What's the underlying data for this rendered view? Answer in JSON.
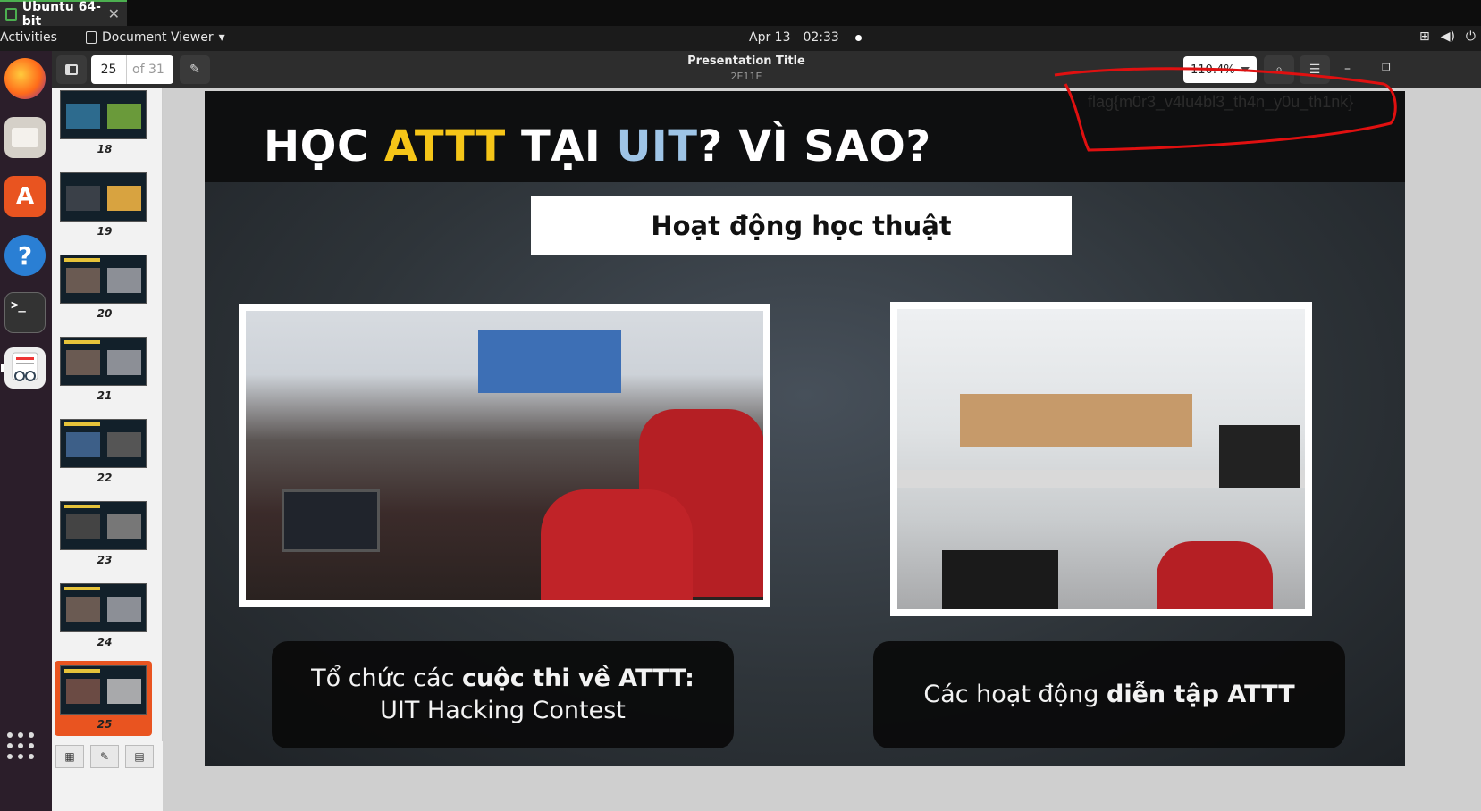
{
  "vm": {
    "tab_title": "Ubuntu 64-bit",
    "close_glyph": "✕"
  },
  "topbar": {
    "activities": "Activities",
    "app_name": "Document Viewer",
    "date": "Apr 13",
    "time": "02:33",
    "tray_icons": [
      "network-icon",
      "volume-icon",
      "power-icon"
    ]
  },
  "dock": {
    "apps": [
      "firefox-icon",
      "files-icon",
      "software-icon",
      "help-icon",
      "terminal-icon",
      "document-viewer-icon",
      "show-apps-icon"
    ],
    "terminal_glyph": ">_",
    "help_glyph": "?",
    "software_glyph": "A"
  },
  "header": {
    "current_page": "25",
    "page_total": "of 31",
    "doc_title": "Presentation Title",
    "doc_subtitle": "2E11E",
    "zoom": "110.4%"
  },
  "thumbnails": {
    "pages": [
      "18",
      "19",
      "20",
      "21",
      "22",
      "23",
      "24",
      "25"
    ],
    "selected": "25"
  },
  "slide": {
    "heading_part1": "HỌC ",
    "heading_part2": "ATTT",
    "heading_part3": " TẠI ",
    "heading_part4": "UIT",
    "heading_part5": "? VÌ SAO?",
    "subheading": "Hoạt động học thuật",
    "caption_left_a": "Tổ chức các ",
    "caption_left_b": "cuộc thi về ATTT:",
    "caption_left_c": " UIT Hacking Contest",
    "caption_right_a": "Các hoạt động ",
    "caption_right_b": "diễn tập ATTT"
  },
  "annotation": {
    "flag_text": "flag{m0r3_v4lu4bl3_th4n_y0u_th1nk}"
  },
  "colors": {
    "accent": "#e95420",
    "heading_yellow": "#f5c518",
    "heading_blue": "#9ec4e6",
    "markup_red": "#e01010"
  }
}
